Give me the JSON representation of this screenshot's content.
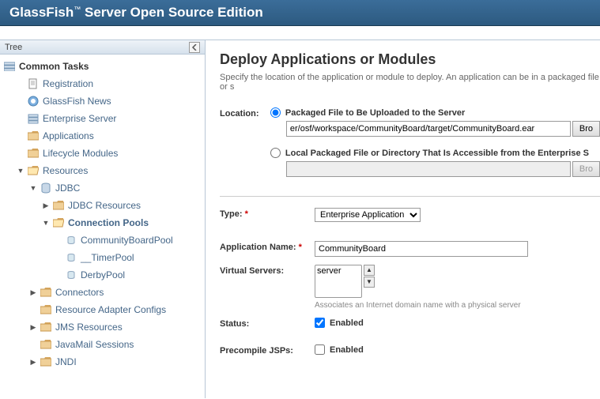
{
  "header": {
    "title_pre": "GlassFish",
    "title_rest": " Server Open Source Edition"
  },
  "sidebar": {
    "title": "Tree",
    "root": "Common Tasks",
    "items": [
      {
        "label": "Registration",
        "lvl": 1,
        "toggle": "none",
        "icon": "doc"
      },
      {
        "label": "GlassFish News",
        "lvl": 1,
        "toggle": "none",
        "icon": "news"
      },
      {
        "label": "Enterprise Server",
        "lvl": 1,
        "toggle": "none",
        "icon": "server"
      },
      {
        "label": "Applications",
        "lvl": 1,
        "toggle": "none",
        "icon": "folder"
      },
      {
        "label": "Lifecycle Modules",
        "lvl": 1,
        "toggle": "none",
        "icon": "folder"
      },
      {
        "label": "Resources",
        "lvl": 1,
        "toggle": "open",
        "icon": "folder-open"
      },
      {
        "label": "JDBC",
        "lvl": 2,
        "toggle": "open",
        "icon": "db"
      },
      {
        "label": "JDBC Resources",
        "lvl": 3,
        "toggle": "closed",
        "icon": "folder"
      },
      {
        "label": "Connection Pools",
        "lvl": 3,
        "toggle": "open",
        "icon": "folder-open",
        "selected": true
      },
      {
        "label": "CommunityBoardPool",
        "lvl": 4,
        "toggle": "none",
        "icon": "dbitem"
      },
      {
        "label": "__TimerPool",
        "lvl": 4,
        "toggle": "none",
        "icon": "dbitem"
      },
      {
        "label": "DerbyPool",
        "lvl": 4,
        "toggle": "none",
        "icon": "dbitem"
      },
      {
        "label": "Connectors",
        "lvl": 2,
        "toggle": "closed",
        "icon": "folder"
      },
      {
        "label": "Resource Adapter Configs",
        "lvl": 2,
        "toggle": "none",
        "icon": "folder"
      },
      {
        "label": "JMS Resources",
        "lvl": 2,
        "toggle": "closed",
        "icon": "folder"
      },
      {
        "label": "JavaMail Sessions",
        "lvl": 2,
        "toggle": "none",
        "icon": "folder"
      },
      {
        "label": "JNDI",
        "lvl": 2,
        "toggle": "closed",
        "icon": "folder"
      }
    ]
  },
  "content": {
    "title": "Deploy Applications or Modules",
    "desc": "Specify the location of the application or module to deploy. An application can be in a packaged file or s",
    "location": {
      "label": "Location:",
      "opt1": "Packaged File to Be Uploaded to the Server",
      "opt1_value": "er/osf/workspace/CommunityBoard/target/CommunityBoard.ear",
      "browse1": "Bro",
      "opt2": "Local Packaged File or Directory That Is Accessible from the Enterprise S",
      "browse2": "Bro"
    },
    "type": {
      "label": "Type:",
      "value": "Enterprise Application"
    },
    "appname": {
      "label": "Application Name:",
      "value": "CommunityBoard"
    },
    "vservers": {
      "label": "Virtual Servers:",
      "option": "server",
      "helper": "Associates an Internet domain name with a physical server"
    },
    "status": {
      "label": "Status:",
      "text": "Enabled"
    },
    "precompile": {
      "label": "Precompile JSPs:",
      "text": "Enabled"
    }
  }
}
